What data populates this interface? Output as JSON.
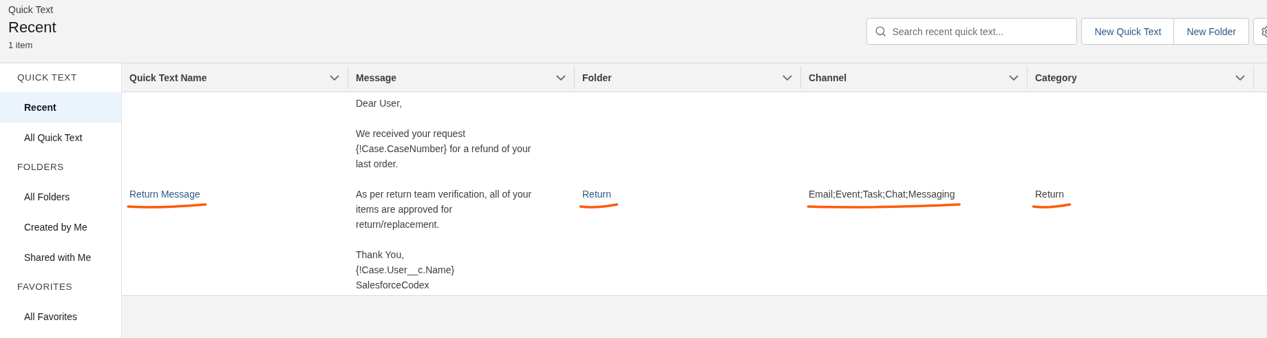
{
  "header": {
    "breadcrumb": "Quick Text",
    "title": "Recent",
    "item_count": "1 item"
  },
  "search": {
    "placeholder": "Search recent quick text..."
  },
  "buttons": [
    "New Quick Text",
    "New Folder"
  ],
  "sidebar": {
    "sections": [
      {
        "heading": "QUICK TEXT",
        "items": [
          {
            "label": "Recent",
            "selected": true
          },
          {
            "label": "All Quick Text",
            "selected": false
          }
        ]
      },
      {
        "heading": "FOLDERS",
        "items": [
          {
            "label": "All Folders",
            "selected": false
          },
          {
            "label": "Created by Me",
            "selected": false
          },
          {
            "label": "Shared with Me",
            "selected": false
          }
        ]
      },
      {
        "heading": "FAVORITES",
        "items": [
          {
            "label": "All Favorites",
            "selected": false
          }
        ]
      }
    ]
  },
  "table": {
    "columns": [
      "Quick Text Name",
      "Message",
      "Folder",
      "Channel",
      "Category"
    ],
    "rows": [
      {
        "cells": [
          {
            "kind": "link",
            "text": "Return Message",
            "annotated": true
          },
          {
            "kind": "text",
            "text": "Dear User,\n\nWe received your request\n{!Case.CaseNumber} for a refund of your\nlast order.\n\nAs per return team verification, all of your\nitems are approved for\nreturn/replacement.\n\nThank You,\n{!Case.User__c.Name}\nSalesforceCodex",
            "annotated": false
          },
          {
            "kind": "link",
            "text": "Return",
            "annotated": true
          },
          {
            "kind": "text",
            "text": "Email;Event;Task;Chat;Messaging",
            "annotated": true
          },
          {
            "kind": "text",
            "text": "Return",
            "annotated": true
          }
        ]
      }
    ]
  }
}
